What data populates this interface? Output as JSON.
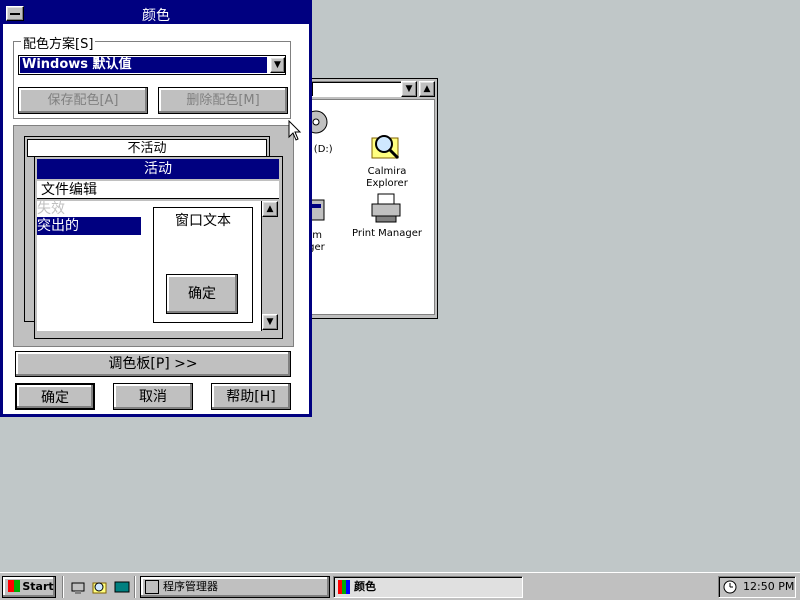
{
  "dialog": {
    "title": "颜色",
    "scheme_group_label": "配色方案[S]",
    "scheme_selected": "Windows 默认值",
    "save_scheme_label": "保存配色[A]",
    "delete_scheme_label": "删除配色[M]",
    "preview": {
      "inactive_title": "不活动",
      "active_title": "活动",
      "menu_text": "文件编辑",
      "disabled_text": "失效",
      "highlight_text": "突出的",
      "window_text": "窗口文本",
      "ok_button_label": "确定"
    },
    "palette_button_label": "调色板[P] >>",
    "ok_label": "确定",
    "cancel_label": "取消",
    "help_label": "帮助[H]"
  },
  "explorer": {
    "icons": [
      {
        "label": "M (D:)",
        "icon": "cd-drive-icon"
      },
      {
        "label": "Calmira Explorer",
        "icon": "magnifier-folder-icon"
      },
      {
        "label": "ram\nager",
        "icon": "program-manager-icon"
      },
      {
        "label": "Print Manager",
        "icon": "printer-icon"
      }
    ]
  },
  "taskbar": {
    "start_label": "Start",
    "tasks": [
      {
        "label": "程序管理器",
        "active": false
      },
      {
        "label": "颜色",
        "active": true
      }
    ],
    "clock": "12:50 PM"
  },
  "colors": {
    "desktop": "#c0c7c8",
    "title_active": "#000080",
    "face": "#c0c0c0"
  }
}
